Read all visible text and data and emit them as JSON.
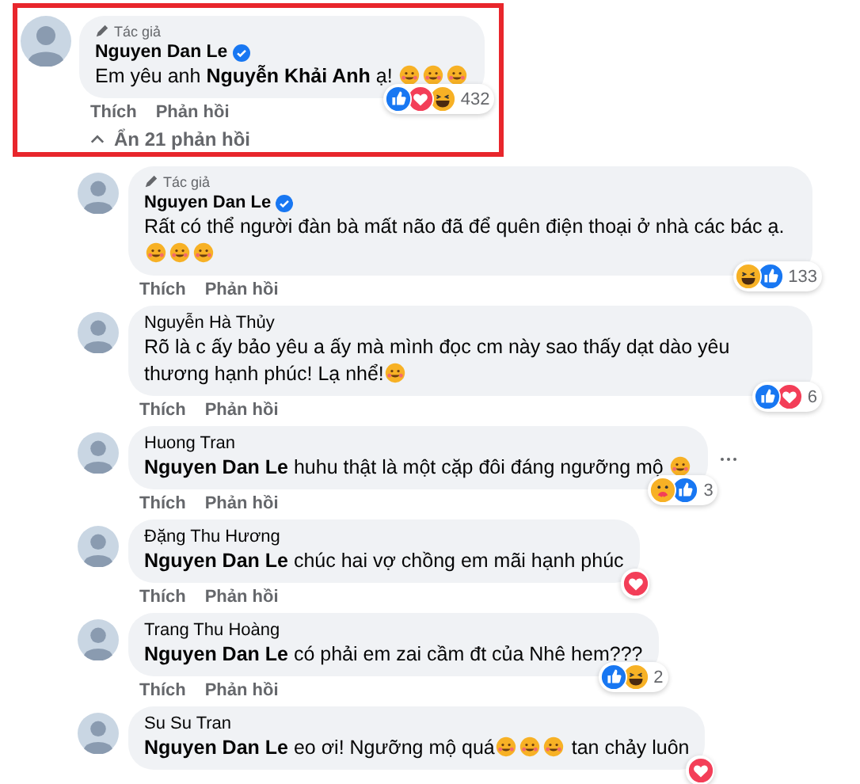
{
  "top_comment": {
    "highlighted": true,
    "badge": "Tác giả",
    "author": "Nguyen Dan Le",
    "verified": true,
    "parts": [
      {
        "kind": "text",
        "text": "Em yêu anh "
      },
      {
        "kind": "mention",
        "text": "Nguyễn Khải Anh"
      },
      {
        "kind": "text",
        "text": " ạ! "
      },
      {
        "kind": "emoji"
      },
      {
        "kind": "emoji"
      },
      {
        "kind": "emoji"
      }
    ],
    "reactions": [
      {
        "kind": "like"
      },
      {
        "kind": "love"
      },
      {
        "kind": "haha"
      }
    ],
    "reaction_count": "432",
    "actions": [
      "Thích",
      "Phản hồi"
    ],
    "toggle": "Ẩn 21 phản hồi"
  },
  "replies": [
    {
      "badge": "Tác giả",
      "author": "Nguyen Dan Le",
      "verified": true,
      "parts": [
        {
          "kind": "text",
          "text": "Rất có thể người đàn bà mất não đã để quên điện thoại ở nhà các bác ạ. "
        },
        {
          "kind": "emoji"
        },
        {
          "kind": "emoji"
        },
        {
          "kind": "emoji"
        }
      ],
      "reactions": [
        {
          "kind": "haha"
        },
        {
          "kind": "like"
        }
      ],
      "reaction_count": "133",
      "actions": [
        "Thích",
        "Phản hồi"
      ],
      "more": false
    },
    {
      "author": "Nguyễn Hà Thủy",
      "verified": false,
      "parts": [
        {
          "kind": "text",
          "text": "Rõ là c ấy bảo yêu a ấy mà mình đọc cm này sao thấy dạt dào yêu thương hạnh phúc! Lạ nhể!"
        },
        {
          "kind": "emoji"
        }
      ],
      "reactions": [
        {
          "kind": "like"
        },
        {
          "kind": "love"
        }
      ],
      "reaction_count": "6",
      "actions": [
        "Thích",
        "Phản hồi"
      ],
      "more": false
    },
    {
      "author": "Huong Tran",
      "verified": false,
      "parts": [
        {
          "kind": "mention",
          "text": "Nguyen Dan Le"
        },
        {
          "kind": "text",
          "text": " huhu thật là một cặp đôi đáng ngưỡng mộ "
        },
        {
          "kind": "emoji"
        }
      ],
      "reactions": [
        {
          "kind": "care"
        },
        {
          "kind": "like"
        }
      ],
      "reaction_count": "3",
      "actions": [
        "Thích",
        "Phản hồi"
      ],
      "more": true
    },
    {
      "author": "Đặng Thu Hương",
      "verified": false,
      "parts": [
        {
          "kind": "mention",
          "text": "Nguyen Dan Le"
        },
        {
          "kind": "text",
          "text": " chúc hai vợ chồng em mãi hạnh phúc"
        }
      ],
      "reactions": [
        {
          "kind": "love"
        }
      ],
      "actions": [
        "Thích",
        "Phản hồi"
      ],
      "more": false
    },
    {
      "author": "Trang Thu Hoàng",
      "verified": false,
      "parts": [
        {
          "kind": "mention",
          "text": "Nguyen Dan Le"
        },
        {
          "kind": "text",
          "text": " có phải em zai cầm đt của Nhê hem???"
        }
      ],
      "reactions": [
        {
          "kind": "like"
        },
        {
          "kind": "haha"
        }
      ],
      "reaction_count": "2",
      "actions": [
        "Thích",
        "Phản hồi"
      ],
      "more": false
    },
    {
      "author": "Su Su Tran",
      "verified": false,
      "parts": [
        {
          "kind": "mention",
          "text": "Nguyen Dan Le"
        },
        {
          "kind": "text",
          "text": " eo ơi! Ngưỡng mộ quá"
        },
        {
          "kind": "emoji"
        },
        {
          "kind": "emoji"
        },
        {
          "kind": "emoji"
        },
        {
          "kind": "text",
          "text": " tan chảy luôn"
        }
      ],
      "reactions": [
        {
          "kind": "love"
        }
      ],
      "more": false
    }
  ]
}
